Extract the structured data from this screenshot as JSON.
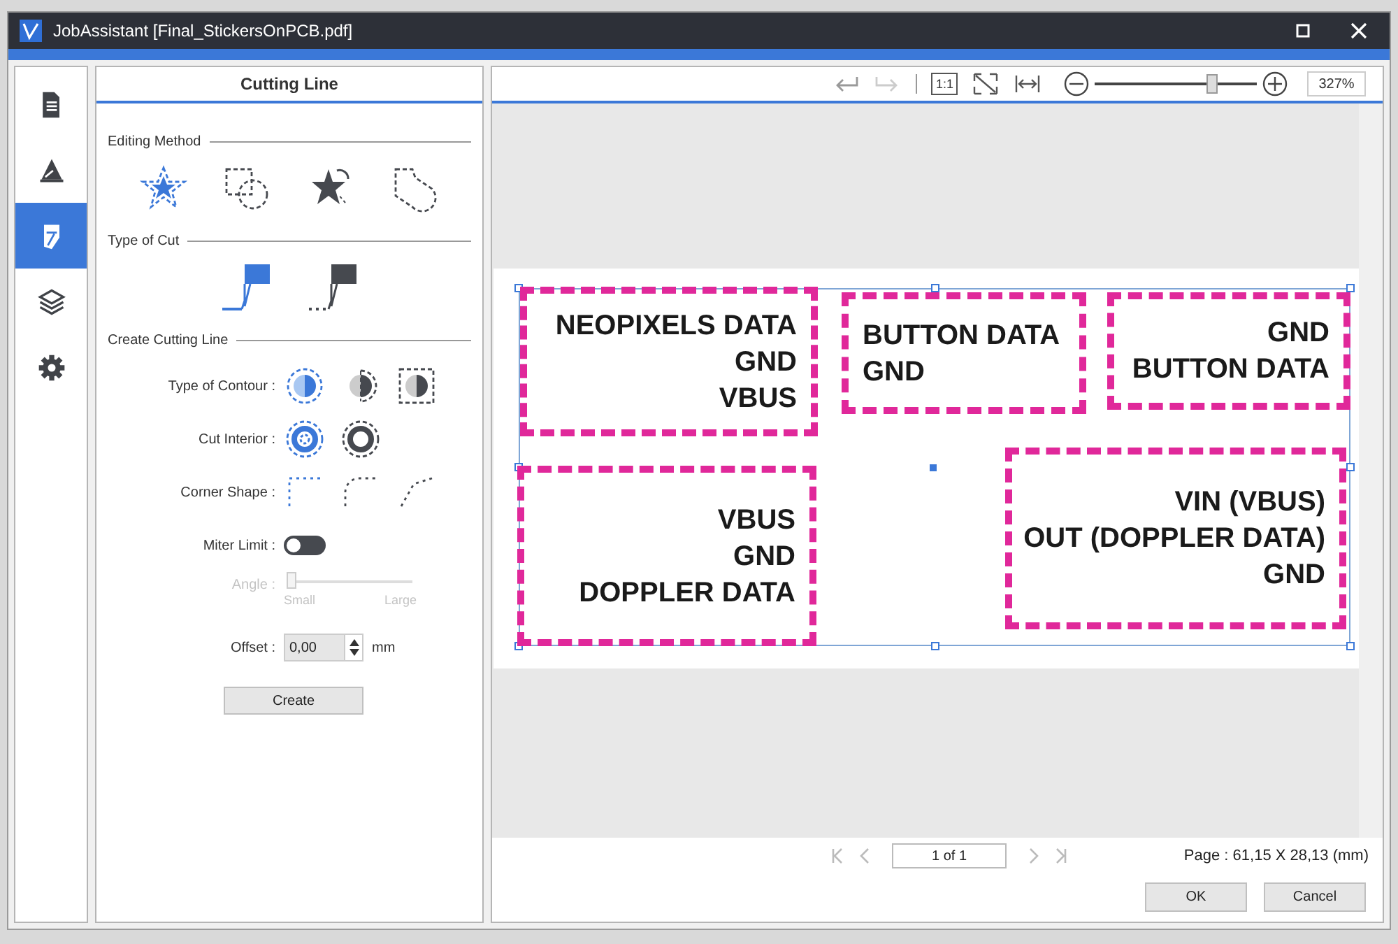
{
  "window": {
    "title": "JobAssistant [Final_StickersOnPCB.pdf]"
  },
  "sidebar": {
    "items": [
      {
        "kind": "document",
        "selected": false
      },
      {
        "kind": "print",
        "selected": false
      },
      {
        "kind": "cutter",
        "selected": true
      },
      {
        "kind": "layers",
        "selected": false
      },
      {
        "kind": "settings",
        "selected": false
      }
    ]
  },
  "panel": {
    "title": "Cutting Line",
    "editing_method": {
      "label": "Editing Method",
      "options": [
        {
          "kind": "star",
          "selected": true
        },
        {
          "kind": "shapes",
          "selected": false
        },
        {
          "kind": "magic",
          "selected": false
        },
        {
          "kind": "freeform",
          "selected": false
        }
      ]
    },
    "type_of_cut": {
      "label": "Type of Cut",
      "options": [
        {
          "kind": "solid",
          "selected": true
        },
        {
          "kind": "dotted",
          "selected": false
        }
      ]
    },
    "create_cutting_line": {
      "label": "Create Cutting Line",
      "type_of_contour": {
        "label": "Type of Contour :",
        "options": [
          {
            "kind": "inner",
            "selected": true
          },
          {
            "kind": "middle",
            "selected": false
          },
          {
            "kind": "box",
            "selected": false
          }
        ]
      },
      "cut_interior": {
        "label": "Cut Interior :",
        "options": [
          {
            "kind": "yes",
            "selected": true
          },
          {
            "kind": "no",
            "selected": false
          }
        ]
      },
      "corner_shape": {
        "label": "Corner Shape :",
        "options": [
          {
            "kind": "square",
            "selected": true
          },
          {
            "kind": "round",
            "selected": false
          },
          {
            "kind": "bevel",
            "selected": false
          }
        ]
      },
      "miter_limit": {
        "label": "Miter Limit :",
        "on": false
      },
      "angle": {
        "label": "Angle :",
        "disabled": true,
        "level": 0,
        "min_label": "Small",
        "max_label": "Large"
      },
      "offset": {
        "label": "Offset :",
        "value": "0,00",
        "unit": "mm"
      },
      "create_button": "Create"
    }
  },
  "toolbar": {
    "zoom_slider": {
      "level": 0.74
    },
    "zoom": "327%",
    "one_to_one": "1:1"
  },
  "stickers": [
    {
      "lines": [
        "NEOPIXELS DATA",
        "GND",
        "VBUS"
      ],
      "kind": "right"
    },
    {
      "lines": [
        "BUTTON DATA",
        "GND"
      ],
      "kind": "left"
    },
    {
      "lines": [
        "GND",
        "BUTTON DATA"
      ],
      "kind": "right"
    },
    {
      "lines": [
        "VBUS",
        "GND",
        "DOPPLER DATA"
      ],
      "kind": "right"
    },
    {
      "lines": [
        "VIN (VBUS)",
        "OUT (DOPPLER DATA)",
        "GND"
      ],
      "kind": "right"
    }
  ],
  "pager": {
    "value": "1 of 1"
  },
  "page_size": "Page :  61,15 X 28,13 (mm)",
  "buttons": [
    "OK",
    "Cancel"
  ]
}
